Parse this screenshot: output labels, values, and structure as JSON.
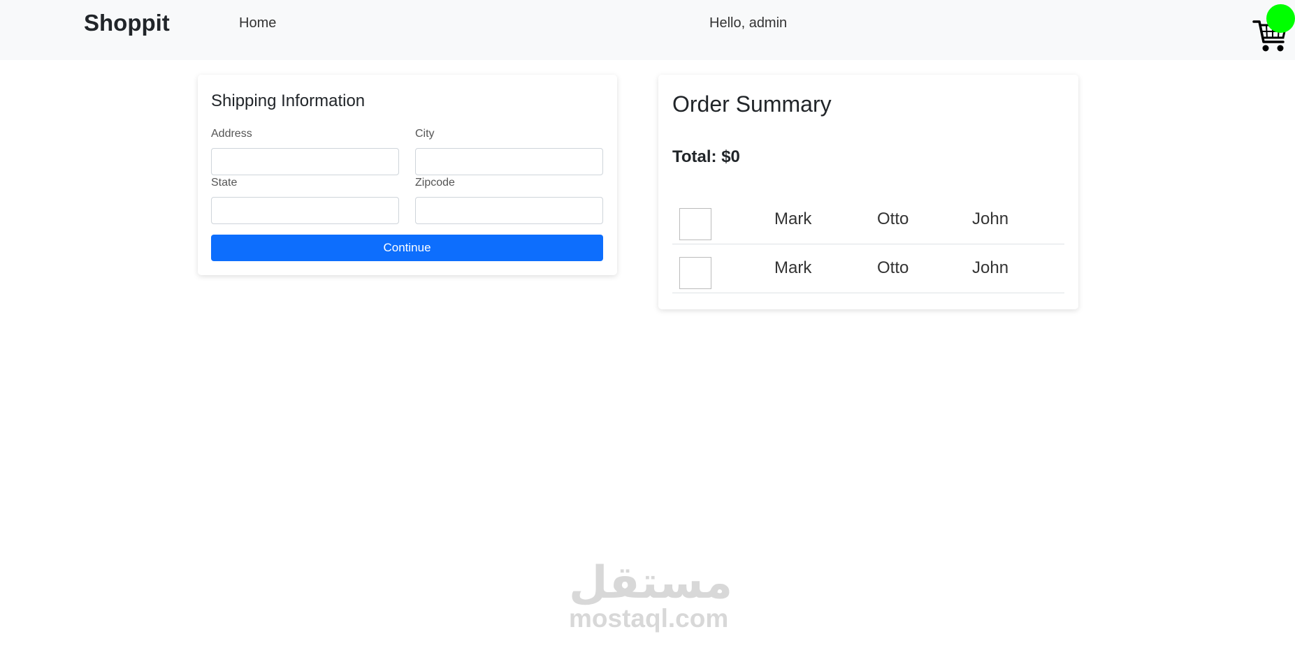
{
  "navbar": {
    "brand": "Shoppit",
    "home_label": "Home",
    "greeting": "Hello, admin",
    "cart_icon": "shopping-cart-icon",
    "badge_color": "#00ff00"
  },
  "shipping": {
    "title": "Shipping Information",
    "fields": [
      {
        "label": "Address",
        "value": "",
        "placeholder": ""
      },
      {
        "label": "City",
        "value": "",
        "placeholder": ""
      },
      {
        "label": "State",
        "value": "",
        "placeholder": ""
      },
      {
        "label": "Zipcode",
        "value": "",
        "placeholder": ""
      }
    ],
    "continue_label": "Continue",
    "button_color": "#0d6efd"
  },
  "order": {
    "title": "Order Summary",
    "total": "Total: $0",
    "rows": [
      {
        "cells": [
          "Mark",
          "Otto",
          "John"
        ]
      },
      {
        "cells": [
          "Mark",
          "Otto",
          "John"
        ]
      }
    ]
  },
  "watermark": {
    "arabic": "مستقل",
    "latin": "mostaql.com"
  }
}
